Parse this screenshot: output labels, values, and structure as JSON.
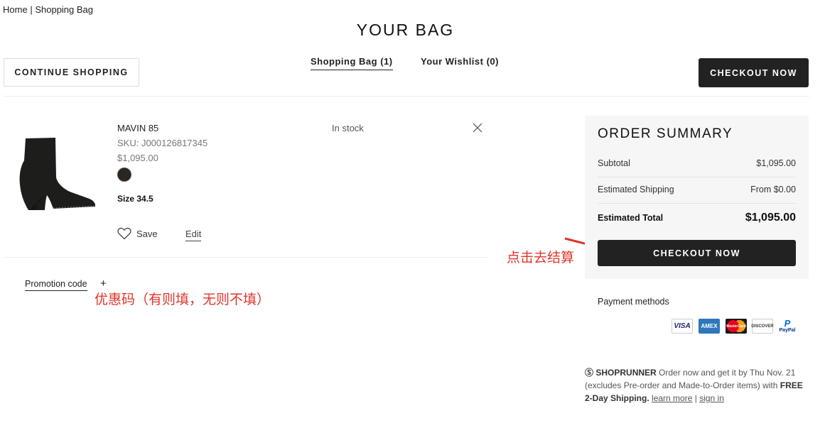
{
  "breadcrumb": {
    "home": "Home",
    "separator": "|",
    "current": "Shopping Bag"
  },
  "page_title": "YOUR BAG",
  "continue_label": "CONTINUE SHOPPING",
  "tabs": [
    {
      "label": "Shopping Bag (1)"
    },
    {
      "label": "Your Wishlist (0)"
    }
  ],
  "checkout_top_label": "CHECKOUT NOW",
  "item": {
    "name": "MAVIN 85",
    "sku": "SKU: J000126817345",
    "price": "$1,095.00",
    "size": "Size 34.5",
    "stock": "In stock",
    "save_label": "Save",
    "edit_label": "Edit"
  },
  "promo": {
    "label": "Promotion code",
    "plus": "+"
  },
  "annotations": {
    "promo_note": "优惠码（有则填，无则不填）",
    "checkout_note": "点击去结算"
  },
  "summary": {
    "title": "ORDER SUMMARY",
    "subtotal_label": "Subtotal",
    "subtotal_value": "$1,095.00",
    "shipping_label": "Estimated Shipping",
    "shipping_value": "From $0.00",
    "total_label": "Estimated Total",
    "total_value": "$1,095.00",
    "checkout_label": "CHECKOUT NOW"
  },
  "payment": {
    "title": "Payment methods",
    "cards": [
      "VISA",
      "AMEX",
      "MasterCard",
      "DISCOVER",
      "PayPal"
    ]
  },
  "shoprunner": {
    "brand": "SHOPRUNNER",
    "text1": "Order now and get it by Thu Nov. 21 (excludes Pre-order and Made-to-Order items) with",
    "free": "FREE 2-Day Shipping.",
    "learn_more": "learn more",
    "separator": "|",
    "sign_in": "sign in"
  },
  "colors": {
    "dark_button": "#222222",
    "annotation_red": "#e0352b",
    "summary_bg": "#f6f6f6"
  }
}
